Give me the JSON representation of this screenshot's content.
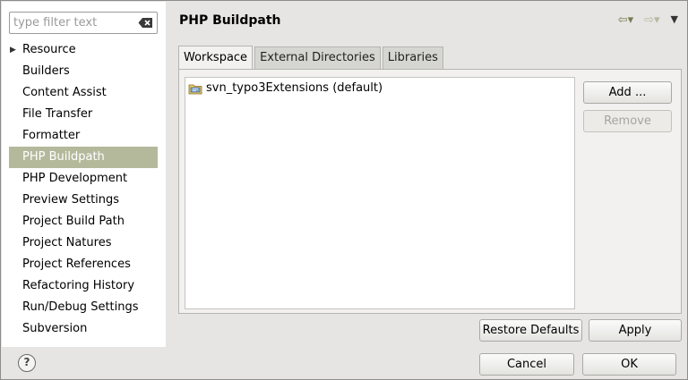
{
  "filter": {
    "placeholder": "type filter text",
    "clear_icon": "clear-filter-icon"
  },
  "tree": {
    "items": [
      {
        "label": "Resource",
        "expandable": true
      },
      {
        "label": "Builders"
      },
      {
        "label": "Content Assist"
      },
      {
        "label": "File Transfer"
      },
      {
        "label": "Formatter"
      },
      {
        "label": "PHP Buildpath",
        "selected": true
      },
      {
        "label": "PHP Development"
      },
      {
        "label": "Preview Settings"
      },
      {
        "label": "Project Build Path"
      },
      {
        "label": "Project Natures"
      },
      {
        "label": "Project References"
      },
      {
        "label": "Refactoring History"
      },
      {
        "label": "Run/Debug Settings"
      },
      {
        "label": "Subversion"
      }
    ],
    "selected_color": "#b5b99c"
  },
  "page": {
    "title": "PHP Buildpath"
  },
  "nav": {
    "back_icon": "back-arrow-icon",
    "forward_icon": "forward-arrow-icon",
    "menu_icon": "view-menu-icon"
  },
  "tabs": [
    {
      "label": "Workspace",
      "active": true
    },
    {
      "label": "External Directories"
    },
    {
      "label": "Libraries"
    }
  ],
  "workspace": {
    "entries": [
      {
        "label": "svn_typo3Extensions (default)",
        "icon": "source-folder-icon"
      }
    ],
    "add_label": "Add ...",
    "remove_label": "Remove"
  },
  "footer": {
    "restore_defaults_label": "Restore Defaults",
    "apply_label": "Apply",
    "cancel_label": "Cancel",
    "ok_label": "OK",
    "help_icon": "help-icon",
    "help_glyph": "?"
  }
}
